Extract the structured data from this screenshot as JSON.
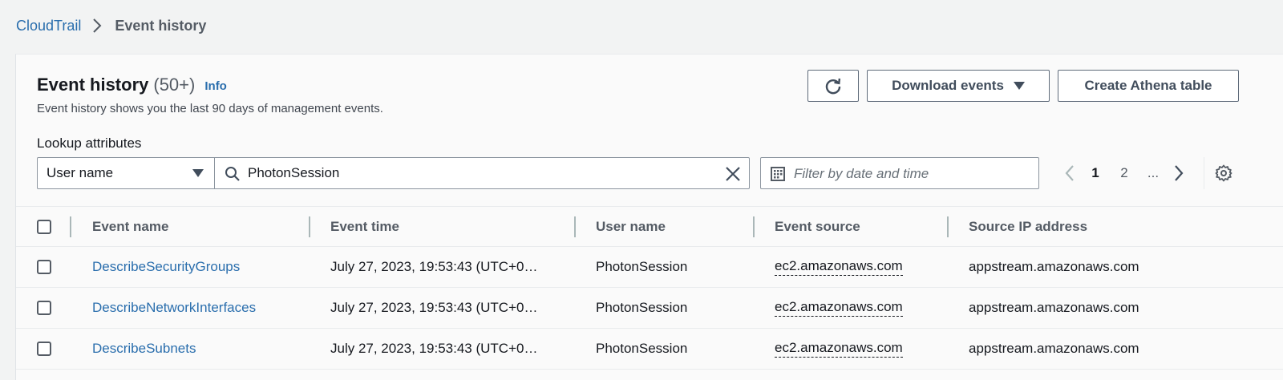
{
  "breadcrumb": {
    "root": "CloudTrail",
    "current": "Event history"
  },
  "header": {
    "title": "Event history",
    "count": "(50+)",
    "info": "Info",
    "description": "Event history shows you the last 90 days of management events."
  },
  "toolbar": {
    "download_label": "Download events",
    "athena_label": "Create Athena table"
  },
  "lookup": {
    "label": "Lookup attributes",
    "attribute": "User name",
    "value": "PhotonSession",
    "date_placeholder": "Filter by date and time"
  },
  "pagination": {
    "pages": [
      "1",
      "2"
    ],
    "ellipsis": "...",
    "current": "1"
  },
  "table": {
    "columns": [
      "Event name",
      "Event time",
      "User name",
      "Event source",
      "Source IP address"
    ],
    "rows": [
      {
        "event_name": "DescribeSecurityGroups",
        "event_time": "July 27, 2023, 19:53:43 (UTC+0…",
        "user_name": "PhotonSession",
        "event_source": "ec2.amazonaws.com",
        "source_ip": "appstream.amazonaws.com"
      },
      {
        "event_name": "DescribeNetworkInterfaces",
        "event_time": "July 27, 2023, 19:53:43 (UTC+0…",
        "user_name": "PhotonSession",
        "event_source": "ec2.amazonaws.com",
        "source_ip": "appstream.amazonaws.com"
      },
      {
        "event_name": "DescribeSubnets",
        "event_time": "July 27, 2023, 19:53:43 (UTC+0…",
        "user_name": "PhotonSession",
        "event_source": "ec2.amazonaws.com",
        "source_ip": "appstream.amazonaws.com"
      }
    ]
  },
  "colors": {
    "link": "#2a6ead",
    "border": "#5f6b7a",
    "background": "#f2f3f3"
  },
  "icons": [
    "chevron-right-icon",
    "refresh-icon",
    "caret-down-icon",
    "search-icon",
    "close-icon",
    "calendar-icon",
    "chevron-left-icon",
    "gear-icon"
  ]
}
